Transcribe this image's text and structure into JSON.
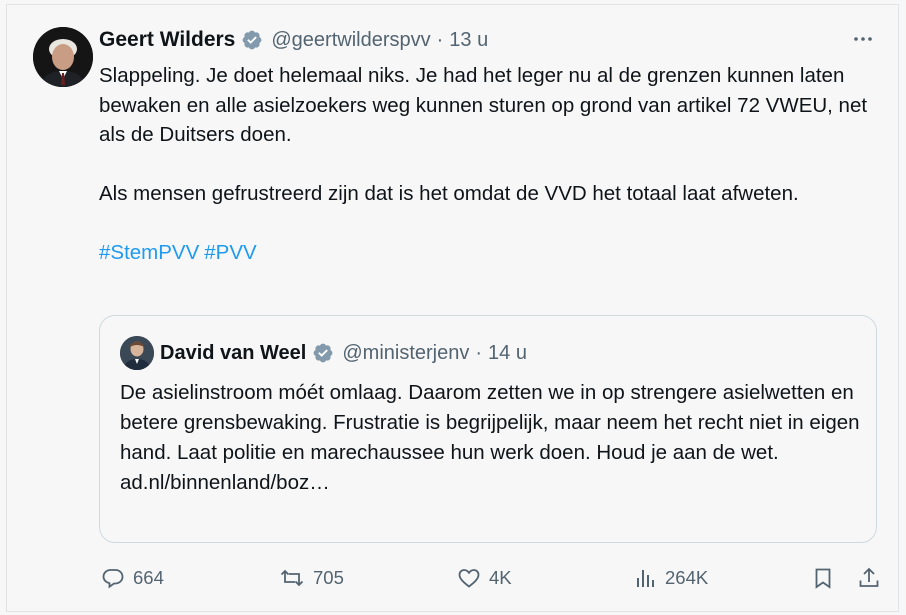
{
  "tweet": {
    "author_name": "Geert Wilders",
    "handle": "@geertwilderspvv",
    "separator": "·",
    "time": "13 u",
    "paragraphs": [
      "Slappeling. Je doet helemaal niks. Je had het leger nu al de grenzen kunnen laten bewaken en alle asielzoekers weg kunnen sturen op grond van artikel 72 VWEU, net als de Duitsers doen.",
      "Als mensen gefrustreerd zijn dat is het omdat de VVD het totaal laat afweten."
    ],
    "hashtags": [
      "#StemPVV",
      "#PVV"
    ]
  },
  "quote": {
    "author_name": "David van Weel",
    "handle": "@ministerjenv",
    "separator": "·",
    "time": "14 u",
    "text": "De asielinstroom móét omlaag. Daarom zetten we in op strengere asielwetten en betere grensbewaking. Frustratie is begrijpelijk, maar neem het recht niet in eigen hand. Laat politie en marechaussee hun werk doen. Houd je aan de wet.",
    "link": "ad.nl/binnenland/boz…"
  },
  "actions": {
    "replies": "664",
    "reposts": "705",
    "likes": "4K",
    "views": "264K"
  },
  "icons": [
    "verified-badge-icon",
    "more-icon",
    "reply-icon",
    "repost-icon",
    "like-icon",
    "views-icon",
    "bookmark-icon",
    "share-icon"
  ],
  "colors": {
    "accent": "#1d9bf0",
    "secondary_text": "#536471",
    "verified": "#829aab"
  }
}
